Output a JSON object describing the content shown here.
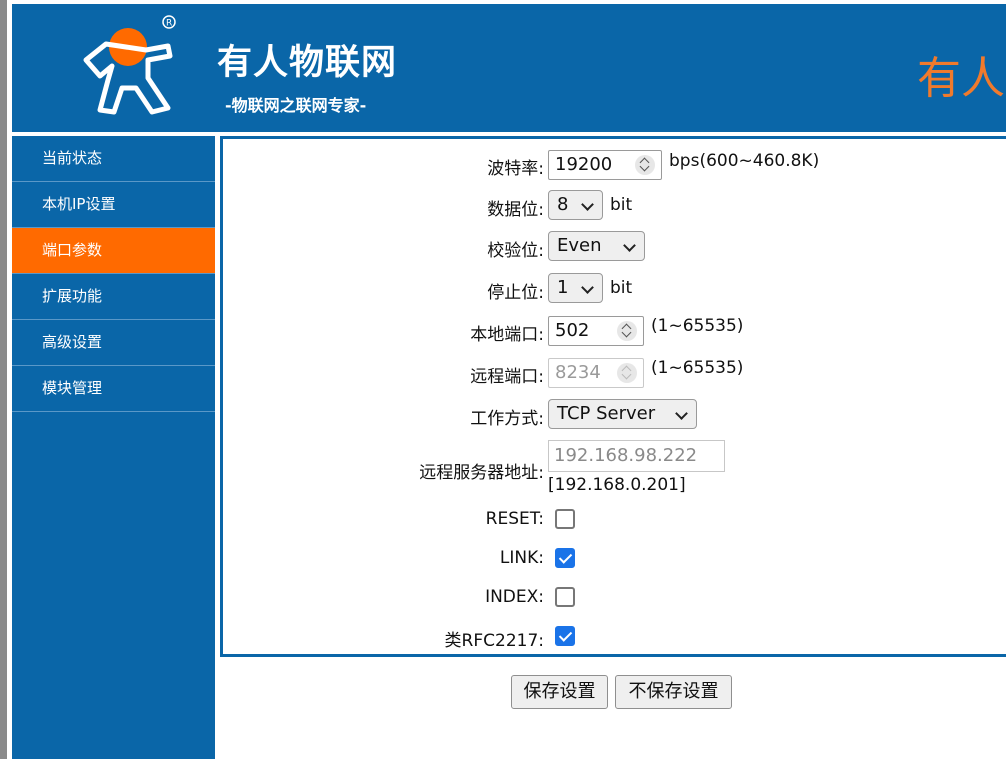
{
  "header": {
    "title": "有人物联网",
    "slogan": "-物联网之联网专家-",
    "right_text": "有人"
  },
  "sidebar": {
    "items": [
      {
        "label": "当前状态",
        "active": false
      },
      {
        "label": "本机IP设置",
        "active": false
      },
      {
        "label": "端口参数",
        "active": true
      },
      {
        "label": "扩展功能",
        "active": false
      },
      {
        "label": "高级设置",
        "active": false
      },
      {
        "label": "模块管理",
        "active": false
      }
    ]
  },
  "form": {
    "baud": {
      "label": "波特率:",
      "value": "19200",
      "unit": "bps(600~460.8K)"
    },
    "databits": {
      "label": "数据位:",
      "value": "8",
      "unit": "bit"
    },
    "parity": {
      "label": "校验位:",
      "value": "Even"
    },
    "stopbits": {
      "label": "停止位:",
      "value": "1",
      "unit": "bit"
    },
    "local_port": {
      "label": "本地端口:",
      "value": "502",
      "range": "(1~65535)"
    },
    "remote_port": {
      "label": "远程端口:",
      "value": "8234",
      "range": "(1~65535)"
    },
    "work_mode": {
      "label": "工作方式:",
      "value": "TCP Server"
    },
    "remote_addr": {
      "label": "远程服务器地址:",
      "placeholder": "192.168.98.222",
      "current": "[192.168.0.201]"
    },
    "reset": {
      "label": "RESET:",
      "checked": false
    },
    "link": {
      "label": "LINK:",
      "checked": true
    },
    "index": {
      "label": "INDEX:",
      "checked": false
    },
    "rfc2217": {
      "label": "类RFC2217:",
      "checked": true
    }
  },
  "buttons": {
    "save": "保存设置",
    "nosave": "不保存设置"
  },
  "colors": {
    "brand_blue": "#0a66a8",
    "active_orange": "#ff6a00",
    "logo_orange": "#f07a2c",
    "checkbox_blue": "#1a73e8"
  }
}
